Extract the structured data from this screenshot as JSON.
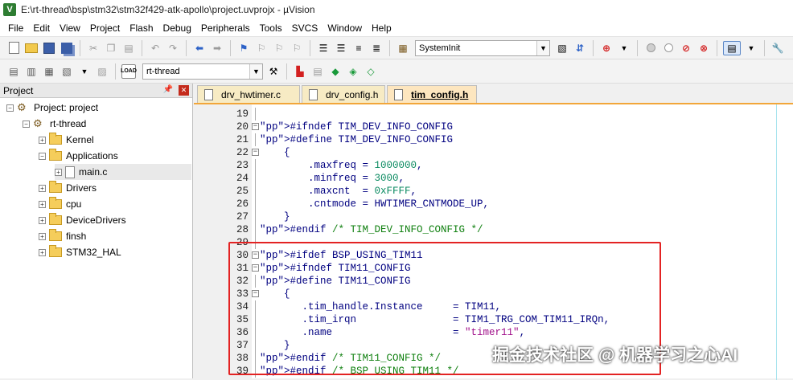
{
  "window": {
    "title": "E:\\rt-thread\\bsp\\stm32\\stm32f429-atk-apollo\\project.uvprojx - µVision",
    "logo": "V"
  },
  "menu": [
    "File",
    "Edit",
    "View",
    "Project",
    "Flash",
    "Debug",
    "Peripherals",
    "Tools",
    "SVCS",
    "Window",
    "Help"
  ],
  "toolbar1": {
    "function_combo": "SystemInit"
  },
  "toolbar2": {
    "target_combo": "rt-thread"
  },
  "project_panel": {
    "title": "Project",
    "tree": [
      {
        "label": "Project: project"
      },
      {
        "label": "rt-thread"
      },
      {
        "label": "Kernel"
      },
      {
        "label": "Applications"
      },
      {
        "label": "main.c"
      },
      {
        "label": "Drivers"
      },
      {
        "label": "cpu"
      },
      {
        "label": "DeviceDrivers"
      },
      {
        "label": "finsh"
      },
      {
        "label": "STM32_HAL"
      }
    ]
  },
  "editor": {
    "tabs": [
      "drv_hwtimer.c",
      "drv_config.h",
      "tim_config.h"
    ],
    "active_tab": "tim_config.h",
    "lines": [
      {
        "n": "19",
        "text": ""
      },
      {
        "n": "20",
        "text": "#ifndef TIM_DEV_INFO_CONFIG"
      },
      {
        "n": "21",
        "text": "#define TIM_DEV_INFO_CONFIG"
      },
      {
        "n": "22",
        "text": "    {"
      },
      {
        "n": "23",
        "text": "        .maxfreq = 1000000,"
      },
      {
        "n": "24",
        "text": "        .minfreq = 3000,"
      },
      {
        "n": "25",
        "text": "        .maxcnt  = 0xFFFF,"
      },
      {
        "n": "26",
        "text": "        .cntmode = HWTIMER_CNTMODE_UP,"
      },
      {
        "n": "27",
        "text": "    }"
      },
      {
        "n": "28",
        "text": "#endif /* TIM_DEV_INFO_CONFIG */"
      },
      {
        "n": "29",
        "text": ""
      },
      {
        "n": "30",
        "text": "#ifdef BSP_USING_TIM11"
      },
      {
        "n": "31",
        "text": "#ifndef TIM11_CONFIG"
      },
      {
        "n": "32",
        "text": "#define TIM11_CONFIG"
      },
      {
        "n": "33",
        "text": "    {"
      },
      {
        "n": "34",
        "text": "       .tim_handle.Instance     = TIM11,"
      },
      {
        "n": "35",
        "text": "       .tim_irqn                = TIM1_TRG_COM_TIM11_IRQn,"
      },
      {
        "n": "36",
        "text": "       .name                    = \"timer11\","
      },
      {
        "n": "37",
        "text": "    }"
      },
      {
        "n": "38",
        "text": "#endif /* TIM11_CONFIG */"
      },
      {
        "n": "39",
        "text": "#endif /* BSP USING TIM11 */"
      }
    ]
  },
  "watermark": "掘金技术社区 @ 机器学习之心AI"
}
